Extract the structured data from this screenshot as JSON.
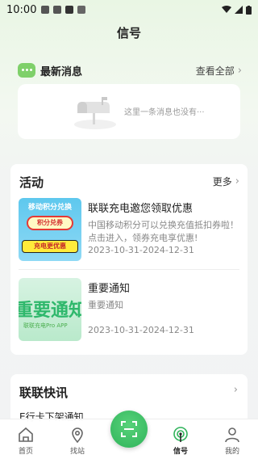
{
  "status_bar": {
    "time": "10:00"
  },
  "header": {
    "title": "信号"
  },
  "messages": {
    "title": "最新消息",
    "view_all": "查看全部",
    "empty_text": "这里一条消息也没有···"
  },
  "activities": {
    "title": "活动",
    "more": "更多",
    "items": [
      {
        "title": "联联充电邀您领取优惠",
        "desc": "中国移动积分可以兑换充值抵扣券啦！ 点击进入，领券充电享优惠!",
        "date": "2023-10-31-2024-12-31",
        "thumb_head": "移动积分兑换",
        "thumb_bubble": "积分兑券",
        "thumb_band": "充电更优惠"
      },
      {
        "title": "重要通知",
        "desc": "重要通知",
        "date": "2023-10-31-2024-12-31",
        "thumb_big": "重要通知",
        "thumb_small": "联联充电Pro APP"
      }
    ]
  },
  "news": {
    "title": "联联快讯",
    "items": [
      "E行卡下架通知"
    ]
  },
  "tabbar": {
    "tabs": [
      {
        "label": "首页",
        "icon": "home-icon"
      },
      {
        "label": "找站",
        "icon": "location-pin-icon"
      },
      {
        "label": "信号",
        "icon": "signal-tower-icon",
        "active": true
      },
      {
        "label": "我的",
        "icon": "person-icon"
      }
    ],
    "scan_icon": "scan-icon"
  },
  "colors": {
    "accent": "#2fb35a",
    "brand_green": "#7fd06a",
    "background": "#f2f3f4"
  }
}
